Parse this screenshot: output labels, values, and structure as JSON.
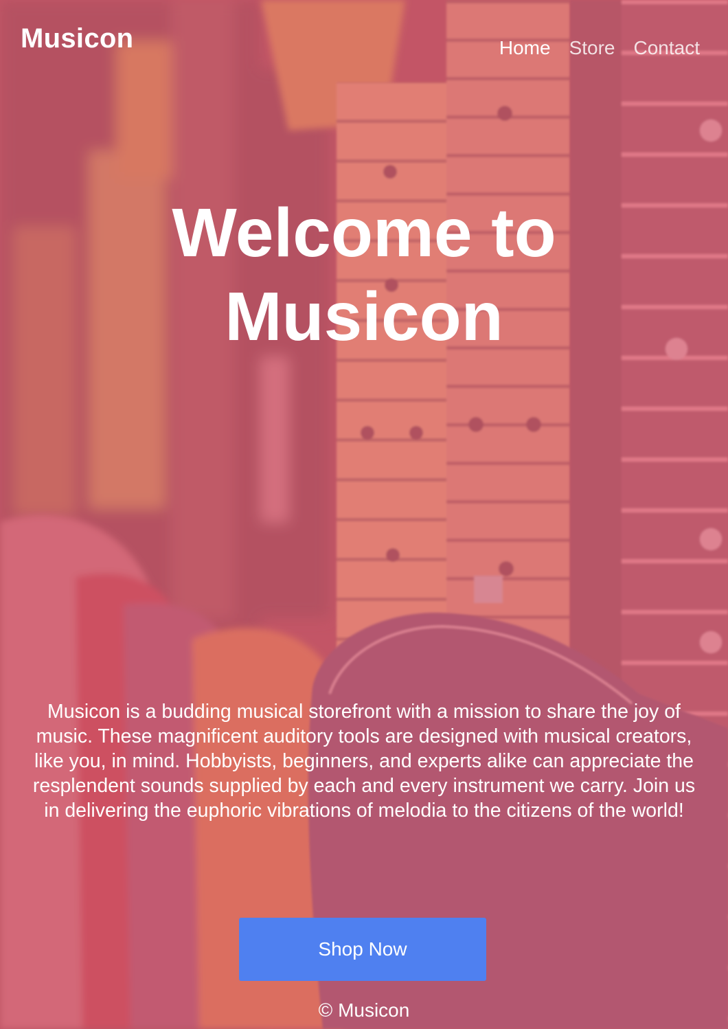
{
  "brand": {
    "name": "Musicon"
  },
  "nav": {
    "items": [
      {
        "label": "Home",
        "active": true
      },
      {
        "label": "Store",
        "active": false
      },
      {
        "label": "Contact",
        "active": false
      }
    ]
  },
  "hero": {
    "title_line1": "Welcome to",
    "title_line2": "Musicon"
  },
  "about": {
    "text": "Musicon is a budding musical storefront with a mission to share the joy of music. These magnificent auditory tools are designed with musical creators, like you, in mind. Hobbyists, beginners, and experts alike can appreciate the resplendent sounds supplied by each and every instrument we carry. Join us in delivering the euphoric vibrations of melodia to the citizens of the world!"
  },
  "cta": {
    "label": "Shop Now"
  },
  "footer": {
    "text": "© Musicon"
  },
  "colors": {
    "overlay": "#d65c70",
    "button": "#4f80f0",
    "text": "#ffffff"
  },
  "background": {
    "icon": "guitars-photo"
  }
}
